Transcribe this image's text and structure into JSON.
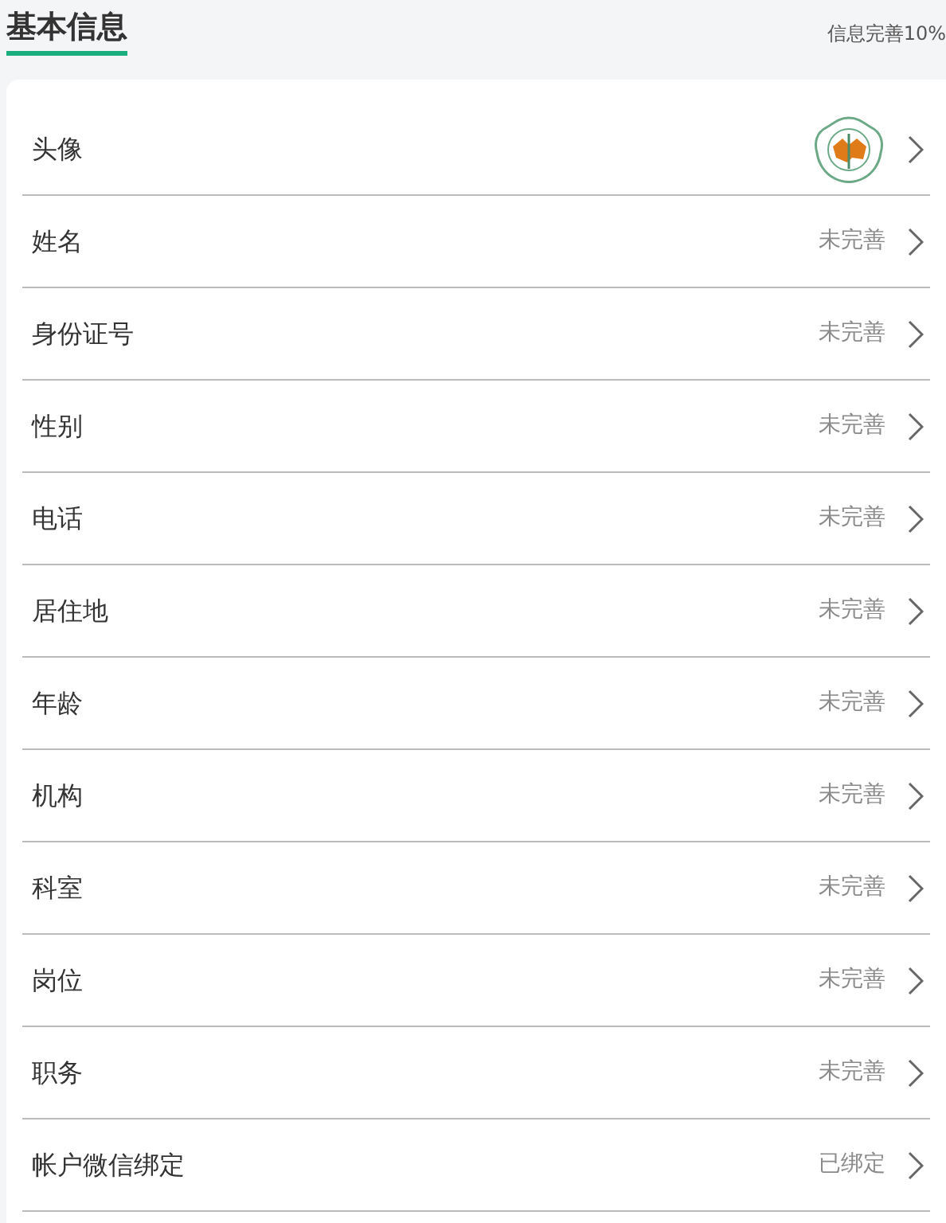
{
  "header": {
    "title": "基本信息",
    "completion": "信息完善10%"
  },
  "rows": [
    {
      "kind": "avatar",
      "label": "头像"
    },
    {
      "kind": "text",
      "label": "姓名",
      "value": "未完善"
    },
    {
      "kind": "text",
      "label": "身份证号",
      "value": "未完善"
    },
    {
      "kind": "text",
      "label": "性别",
      "value": "未完善"
    },
    {
      "kind": "text",
      "label": "电话",
      "value": "未完善"
    },
    {
      "kind": "text",
      "label": "居住地",
      "value": "未完善"
    },
    {
      "kind": "text",
      "label": "年龄",
      "value": "未完善"
    },
    {
      "kind": "text",
      "label": "机构",
      "value": "未完善"
    },
    {
      "kind": "text",
      "label": "科室",
      "value": "未完善"
    },
    {
      "kind": "text",
      "label": "岗位",
      "value": "未完善"
    },
    {
      "kind": "text",
      "label": "职务",
      "value": "未完善"
    },
    {
      "kind": "text",
      "label": "帐户微信绑定",
      "value": "已绑定"
    }
  ]
}
